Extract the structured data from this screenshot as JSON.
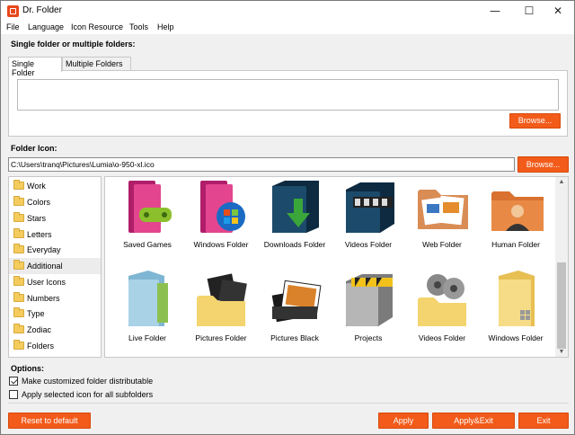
{
  "window": {
    "title": "Dr. Folder"
  },
  "titlebar_controls": {
    "minimize": "—",
    "maximize": "☐",
    "close": "✕"
  },
  "menu": [
    "File",
    "Language",
    "Icon Resource",
    "Tools",
    "Help"
  ],
  "source": {
    "heading": "Single folder or multiple folders:",
    "tabs": [
      "Single Folder",
      "Multiple Folders"
    ],
    "browse_label": "Browse..."
  },
  "folder_icon": {
    "heading": "Folder Icon:",
    "path": "C:\\Users\\tranq\\Pictures\\Lumia\\o-950-xl.ico",
    "browse_label": "Browse..."
  },
  "categories": [
    "Work",
    "Colors",
    "Stars",
    "Letters",
    "Everyday",
    "Additional",
    "User Icons",
    "Numbers",
    "Type",
    "Zodiac",
    "Folders"
  ],
  "selected_category": "Additional",
  "icons": [
    {
      "label": "Saved Games",
      "icon": "saved-games-folder-icon"
    },
    {
      "label": "Windows Folder",
      "icon": "windows-folder-icon"
    },
    {
      "label": "Downloads Folder",
      "icon": "downloads-folder-icon"
    },
    {
      "label": "Videos Folder",
      "icon": "videos-folder-icon"
    },
    {
      "label": "Web Folder",
      "icon": "web-folder-icon"
    },
    {
      "label": "Human Folder",
      "icon": "human-folder-icon"
    },
    {
      "label": "Live Folder",
      "icon": "live-folder-icon"
    },
    {
      "label": "Pictures Folder",
      "icon": "pictures-folder-icon"
    },
    {
      "label": "Pictures Black",
      "icon": "pictures-black-icon"
    },
    {
      "label": "Projects",
      "icon": "projects-folder-icon"
    },
    {
      "label": "Videos Folder",
      "icon": "videos-folder-yellow-icon"
    },
    {
      "label": "Windows Folder",
      "icon": "windows-folder-yellow-icon"
    }
  ],
  "options": {
    "heading": "Options:",
    "items": [
      {
        "label": "Make customized folder distributable",
        "checked": true
      },
      {
        "label": "Apply selected icon for all subfolders",
        "checked": false
      }
    ]
  },
  "footer": {
    "reset": "Reset to default",
    "apply": "Apply",
    "apply_exit": "Apply&Exit",
    "exit": "Exit"
  },
  "colors": {
    "accent": "#f25b1a",
    "window_bg": "#f0f0f0"
  }
}
